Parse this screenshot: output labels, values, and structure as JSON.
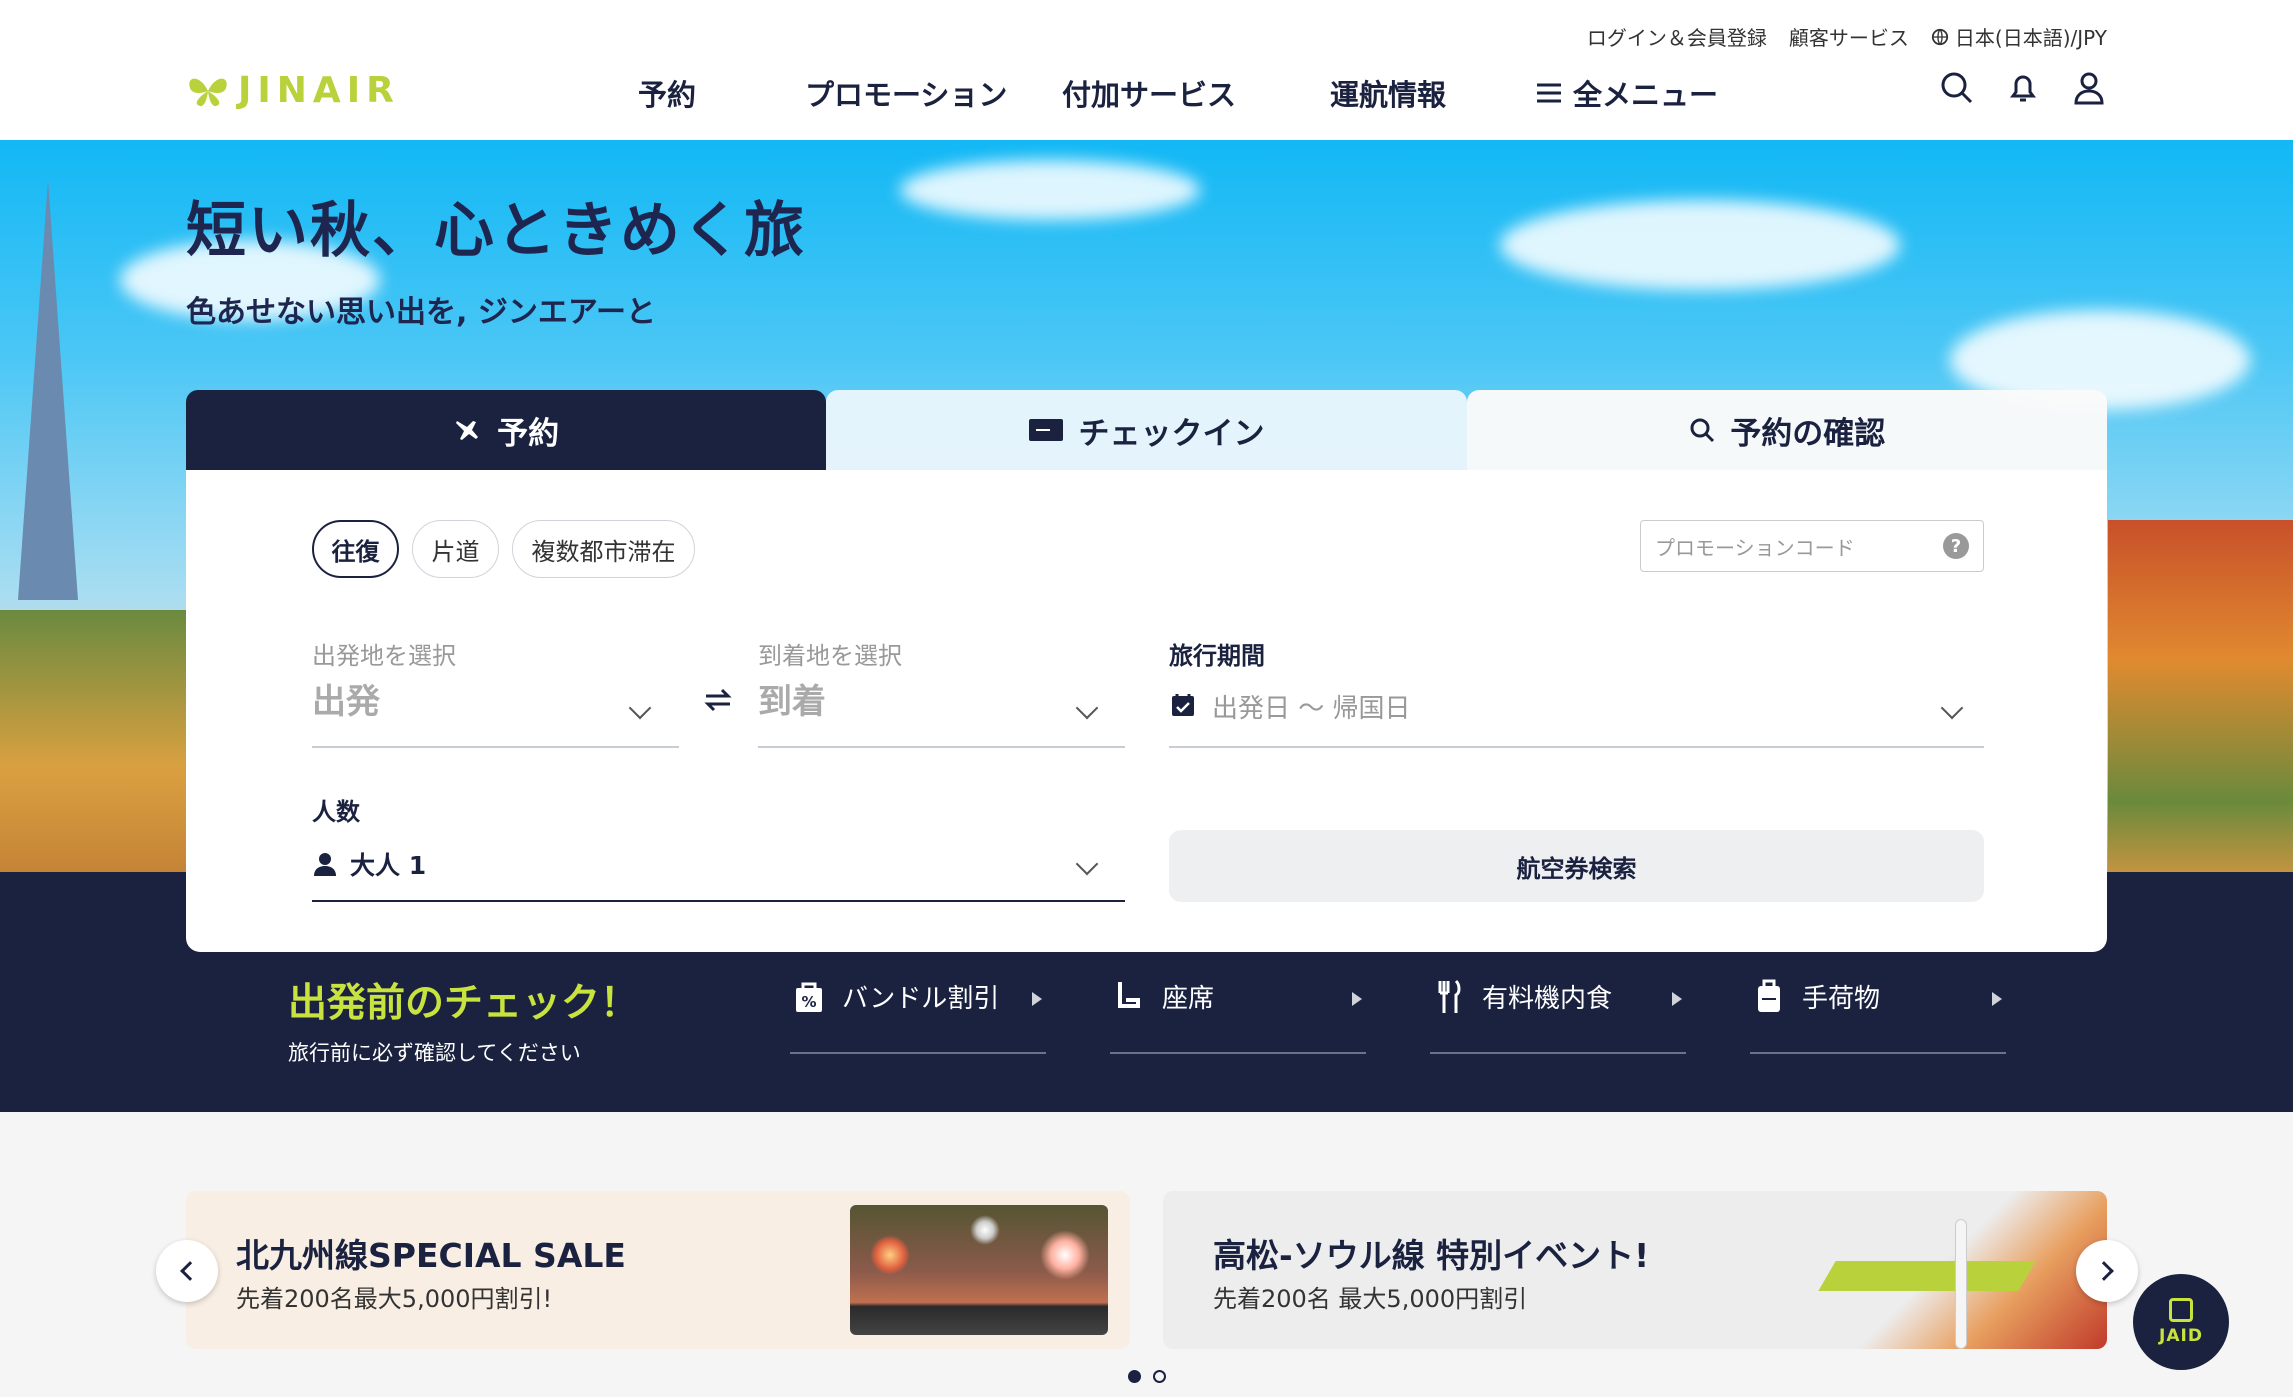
{
  "header": {
    "logo_text": "JINAIR",
    "util_links": [
      "ログイン＆会員登録",
      "顧客サービス",
      "日本(日本語)/JPY"
    ],
    "nav": [
      "予約",
      "プロモーション",
      "付加サービス",
      "運航情報",
      "全メニュー"
    ],
    "icons": [
      "search-icon",
      "bell-icon",
      "user-icon"
    ]
  },
  "hero": {
    "title": "短い秋、心ときめく旅",
    "subtitle": "色あせない思い出を, ジンエアーと"
  },
  "booking": {
    "tabs": [
      "予約",
      "チェックイン",
      "予約の確認"
    ],
    "trip_types": [
      "往復",
      "片道",
      "複数都市滞在"
    ],
    "selected_trip_type": "往復",
    "promo_placeholder": "プロモーションコード",
    "help": "?",
    "departure": {
      "label": "出発地を選択",
      "value": "出発"
    },
    "arrival": {
      "label": "到着地を選択",
      "value": "到着"
    },
    "period": {
      "label": "旅行期間",
      "placeholder": "出発日 ～ 帰国日"
    },
    "passengers": {
      "label": "人数",
      "value": "大人 1"
    },
    "search_label": "航空券検索"
  },
  "check": {
    "title": "出発前のチェック！",
    "subtitle": "旅行前に必ず確認してください",
    "items": [
      "バンドル割引",
      "座席",
      "有料機内食",
      "手荷物"
    ]
  },
  "banners": [
    {
      "title": "北九州線SPECIAL SALE",
      "subtitle": "先着200名最大5,000円割引!"
    },
    {
      "title": "高松-ソウル線 特別イベント!",
      "subtitle": "先着200名 最大5,000円割引"
    }
  ],
  "carousel": {
    "total": 2,
    "current": 1
  },
  "chatbot": {
    "label": "JAID"
  },
  "colors": {
    "navy": "#1b2240",
    "lime": "#c8e23e",
    "brand": "#b9d23c"
  }
}
